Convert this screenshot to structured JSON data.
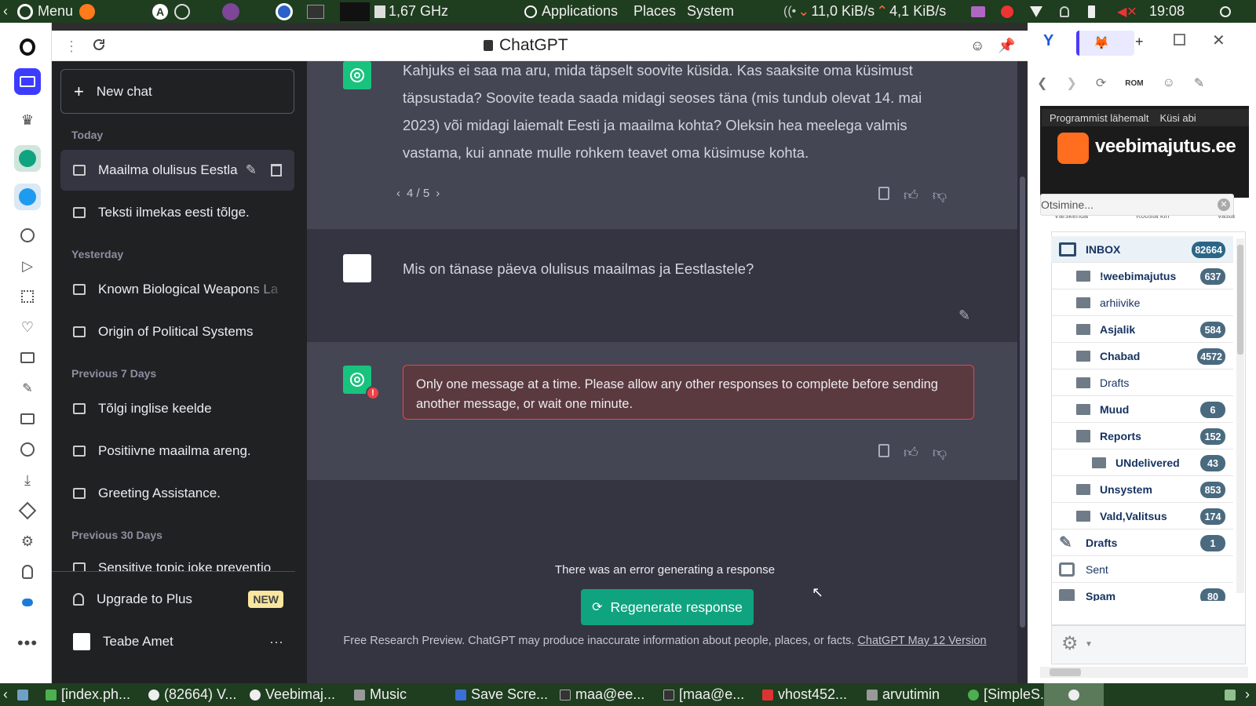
{
  "topbar": {
    "menu_label": "Menu",
    "cpu_freq": "1,67 GHz",
    "applications": "Applications",
    "places": "Places",
    "system": "System",
    "net_down": "11,0 KiB/s",
    "net_up": "4,1 KiB/s",
    "clock": "19:08"
  },
  "browser": {
    "title": "ChatGPT"
  },
  "sidebar": {
    "new_chat": "New chat",
    "sections": {
      "today": "Today",
      "yesterday": "Yesterday",
      "prev7": "Previous 7 Days",
      "prev30": "Previous 30 Days"
    },
    "items": [
      {
        "label": "Maailma olulisus Eestla"
      },
      {
        "label": "Teksti ilmekas eesti tõlge."
      },
      {
        "label": "Known Biological Weapons La"
      },
      {
        "label": "Origin of Political Systems"
      },
      {
        "label": "Tõlgi inglise keelde"
      },
      {
        "label": "Positiivne maailma areng."
      },
      {
        "label": "Greeting Assistance."
      },
      {
        "label": "Sensitive topic joke preventio"
      }
    ],
    "upgrade": "Upgrade to Plus",
    "new_badge": "NEW",
    "user": "Teabe Amet"
  },
  "chat": {
    "bot_message": "Kahjuks ei saa ma aru, mida täpselt soovite küsida. Kas saaksite oma küsimust täpsustada? Soovite teada saada midagi seoses täna (mis tundub olevat 14. mai 2023) või midagi laiemalt Eesti ja maailma kohta? Oleksin hea meelega valmis vastama, kui annate mulle rohkem teavet oma küsimuse kohta.",
    "pager": "4 / 5",
    "user_message": "Mis on tänase päeva olulisus maailmas ja Eestlastele?",
    "error_message": "Only one message at a time. Please allow any other responses to complete before sending another message, or wait one minute.",
    "error_notice": "There was an error generating a response",
    "regenerate": "Regenerate response",
    "footer_text": "Free Research Preview. ChatGPT may produce inaccurate information about people, places, or facts.",
    "footer_link": "ChatGPT May 12 Version"
  },
  "mail": {
    "nav1": "Programmist lähemalt",
    "nav2": "Küsi abi",
    "logo": "veebimajutus.ee",
    "search_placeholder": "Otsimine...",
    "toolbar_labels": [
      "Värskenda",
      "Koosta kiri",
      "Vasta"
    ],
    "folders": [
      {
        "name": "INBOX",
        "count": "82664"
      },
      {
        "name": "!weebimajutus",
        "count": "637"
      },
      {
        "name": "arhiivike",
        "count": ""
      },
      {
        "name": "Asjalik",
        "count": "584"
      },
      {
        "name": "Chabad",
        "count": "4572"
      },
      {
        "name": "Drafts",
        "count": ""
      },
      {
        "name": "Muud",
        "count": "6"
      },
      {
        "name": "Reports",
        "count": "152"
      },
      {
        "name": "UNdelivered",
        "count": "43"
      },
      {
        "name": "Unsystem",
        "count": "853"
      },
      {
        "name": "Vald,Valitsus",
        "count": "174"
      },
      {
        "name": "Drafts",
        "count": "1"
      },
      {
        "name": "Sent",
        "count": ""
      },
      {
        "name": "Spam",
        "count": "80"
      }
    ]
  },
  "taskbar": [
    {
      "label": "[index.ph..."
    },
    {
      "label": "(82664) V..."
    },
    {
      "label": "Veebimaj..."
    },
    {
      "label": "Music"
    },
    {
      "label": "Save Scre..."
    },
    {
      "label": "maa@ee..."
    },
    {
      "label": "[maa@e..."
    },
    {
      "label": "vhost452..."
    },
    {
      "label": "arvutimin"
    },
    {
      "label": "[SimpleS..."
    }
  ]
}
